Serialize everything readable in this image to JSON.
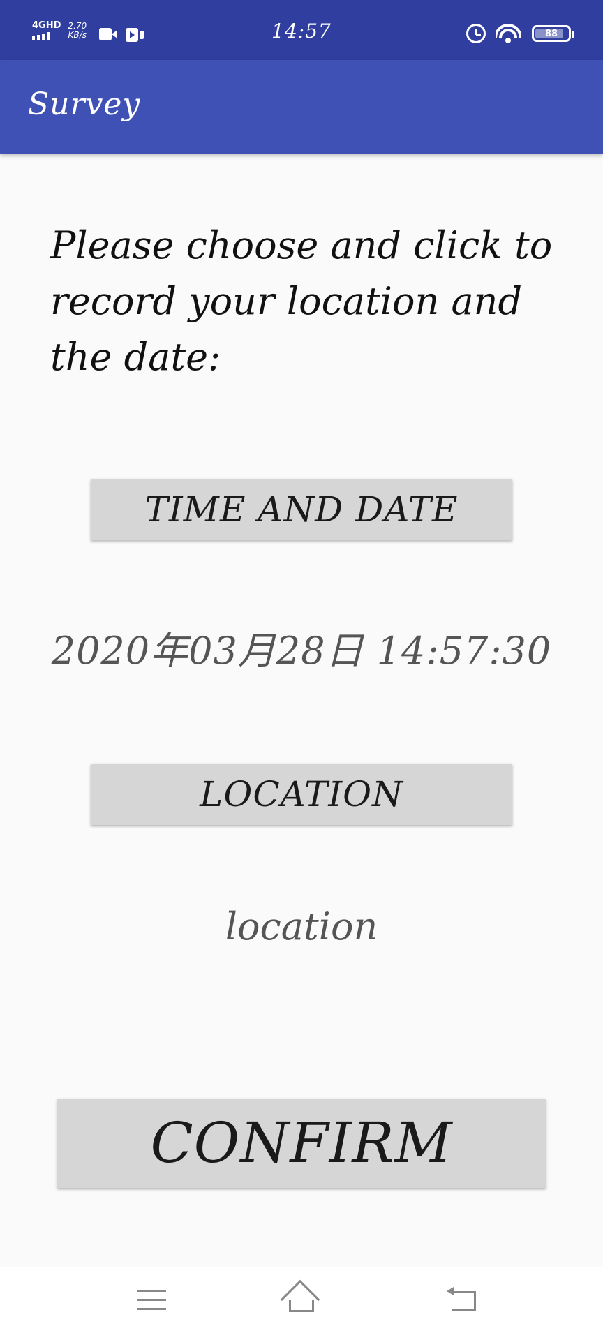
{
  "status_bar": {
    "network_type": "4GHD",
    "speed_value": "2.70",
    "speed_unit": "KB/s",
    "time": "14:57",
    "battery_level": 88,
    "battery_label": "88",
    "icons": [
      "signal-bars-icon",
      "video-camera-icon",
      "video-play-icon",
      "alarm-icon",
      "wifi-icon",
      "battery-icon"
    ]
  },
  "app_bar": {
    "title": "Survey",
    "color": "#3f51b5",
    "status_color": "#303f9f"
  },
  "main": {
    "instructions": "Please choose and click to record your location and the date:",
    "time_button_label": "TIME AND DATE",
    "datetime_value": "2020年03月28日 14:57:30",
    "location_button_label": "LOCATION",
    "location_value": "location",
    "confirm_button_label": "CONFIRM"
  },
  "nav_bar": {
    "icons": [
      "menu-icon",
      "home-icon",
      "back-icon"
    ]
  }
}
